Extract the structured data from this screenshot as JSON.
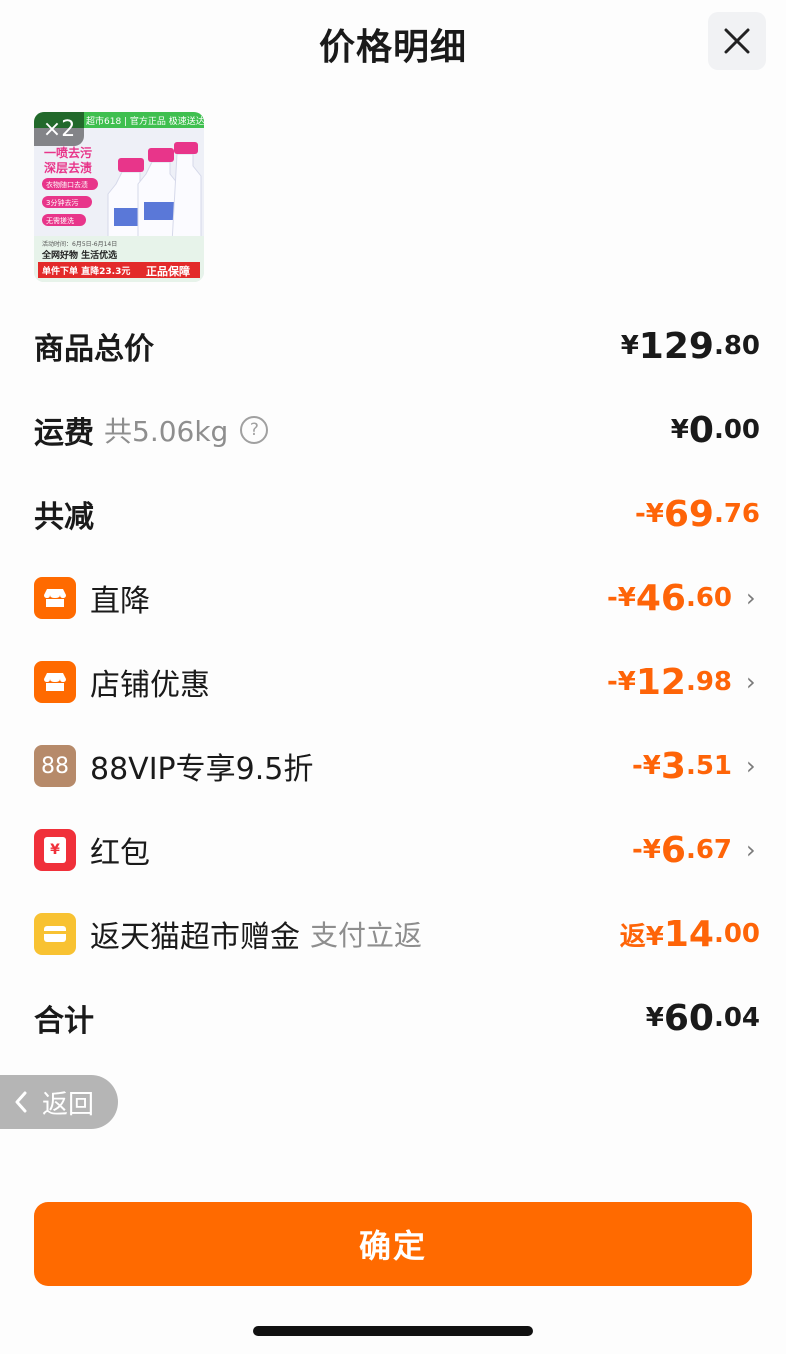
{
  "header": {
    "title": "价格明细"
  },
  "product": {
    "quantity": "×2",
    "image_texts": {
      "banner": "超市618 | 官方正品 极速送达",
      "headline1": "一喷去污",
      "headline2": "深层去渍",
      "bullet1": "衣物随口去渍",
      "bullet2": "3分钟去污",
      "bullet3": "无需搓洗",
      "promo_date": "活动时间：6月5日-6月14日",
      "slogan": "全网好物 生活优选",
      "promo": "单件下单 直降23.3元",
      "guarantee": "正品保障"
    }
  },
  "rows": {
    "total": {
      "label": "商品总价",
      "cur": "¥",
      "int": "129",
      "dec": ".80"
    },
    "shipping": {
      "label": "运费",
      "sub": "共5.06kg",
      "info": "?",
      "cur": "¥",
      "int": "0",
      "dec": ".00"
    },
    "reduction": {
      "label": "共减",
      "cur": "-¥",
      "int": "69",
      "dec": ".76"
    },
    "direct": {
      "label": "直降",
      "cur": "-¥",
      "int": "46",
      "dec": ".60",
      "chevron": "›"
    },
    "store": {
      "label": "店铺优惠",
      "cur": "-¥",
      "int": "12",
      "dec": ".98",
      "chevron": "›"
    },
    "vip": {
      "label": "88VIP专享9.5折",
      "icon_text": "88",
      "cur": "-¥",
      "int": "3",
      "dec": ".51",
      "chevron": "›"
    },
    "redpacket": {
      "label": "红包",
      "icon_text": "¥",
      "cur": "-¥",
      "int": "6",
      "dec": ".67",
      "chevron": "›"
    },
    "cashback": {
      "label": "返天猫超市赠金",
      "sub": "支付立返",
      "cur": "返¥",
      "int": "14",
      "dec": ".00"
    },
    "sum": {
      "label": "合计",
      "cur": "¥",
      "int": "60",
      "dec": ".04"
    }
  },
  "back": {
    "label": "返回"
  },
  "confirm": {
    "label": "确定"
  },
  "colors": {
    "accent": "#ff6a00",
    "orange_text": "#fe6408",
    "vip": "#b68a6a",
    "red": "#f0303a",
    "yellow": "#f8c232"
  }
}
